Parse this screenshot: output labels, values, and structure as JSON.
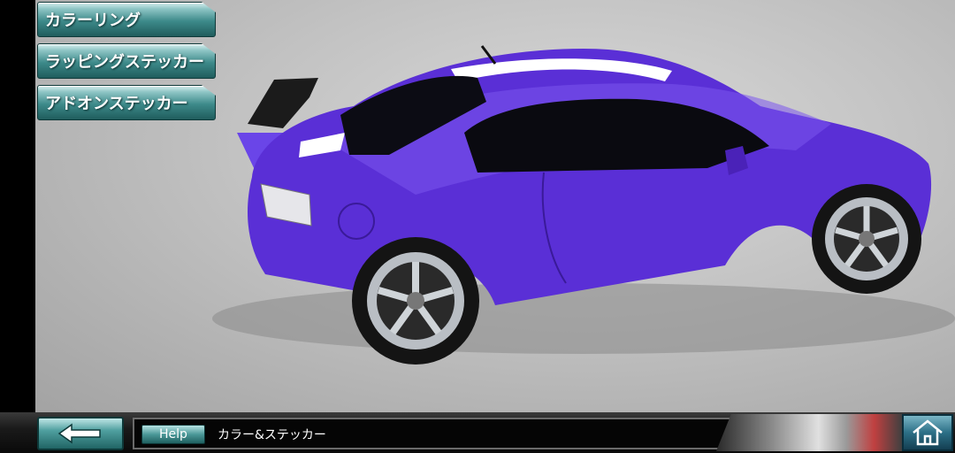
{
  "menu": {
    "coloring": "カラーリング",
    "wrapping_sticker": "ラッピングステッカー",
    "addon_sticker": "アドオンステッカー"
  },
  "bottom": {
    "help_label": "Help",
    "help_text": "カラー&ステッカー",
    "back_icon": "back-arrow-icon",
    "home_icon": "home-icon"
  },
  "scene": {
    "car_color": "#5a2fd6",
    "stripe_color": "#ffffff",
    "wheel_color": "#b9bec4"
  }
}
